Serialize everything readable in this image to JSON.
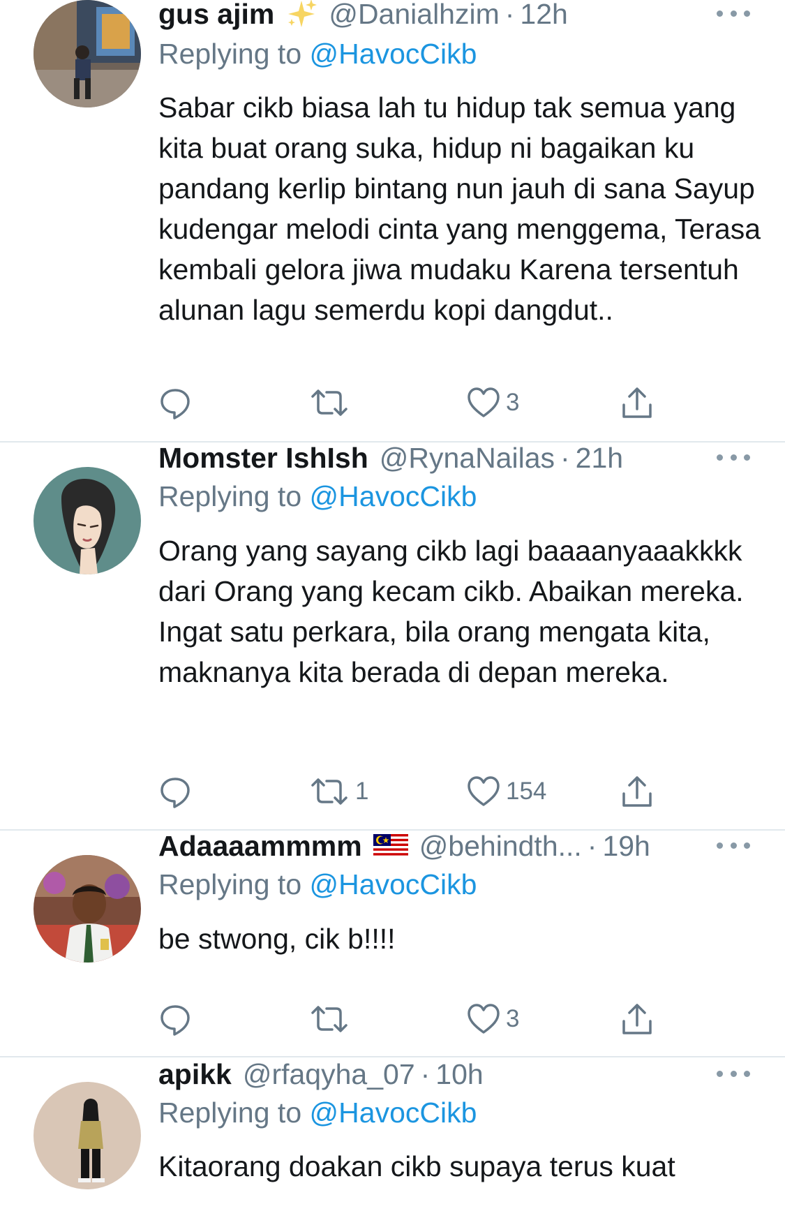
{
  "reply_prefix": "Replying to",
  "tweets": [
    {
      "name": "gus ajim",
      "emoji": "sparkles-emoji",
      "handle": "@Danialhzim",
      "time": "12h",
      "replying_to": "@HavocCikb",
      "text": "Sabar cikb biasa lah tu hidup tak semua yang kita buat orang suka, hidup ni bagaikan ku pandang kerlip bintang nun jauh di sana Sayup kudengar melodi cinta yang menggema, Terasa kembali gelora jiwa mudaku Karena tersentuh alunan lagu semerdu kopi dangdut..",
      "replies": "",
      "retweets": "",
      "likes": "3"
    },
    {
      "name": "Momster IshIsh",
      "emoji": "",
      "handle": "@RynaNailas",
      "time": "21h",
      "replying_to": "@HavocCikb",
      "text": "Orang yang sayang cikb lagi baaaanyaaakkkk dari Orang yang kecam cikb. Abaikan mereka. Ingat satu perkara, bila orang mengata kita, maknanya kita berada di depan mereka.",
      "replies": "",
      "retweets": "1",
      "likes": "154"
    },
    {
      "name": "Adaaaammmm",
      "emoji": "malaysia-flag-emoji",
      "handle": "@behindth...",
      "time": "19h",
      "replying_to": "@HavocCikb",
      "text": "be stwong, cik b!!!!",
      "replies": "",
      "retweets": "",
      "likes": "3"
    },
    {
      "name": "apikk",
      "emoji": "",
      "handle": "@rfaqyha_07",
      "time": "10h",
      "replying_to": "@HavocCikb",
      "text": "Kitaorang doakan cikb supaya terus kuat",
      "replies": "",
      "retweets": "",
      "likes": ""
    }
  ],
  "colors": {
    "text": "#14171a",
    "secondary": "#657786",
    "link": "#1b95e0",
    "divider": "#e1e8ed",
    "icon": "#657786"
  }
}
